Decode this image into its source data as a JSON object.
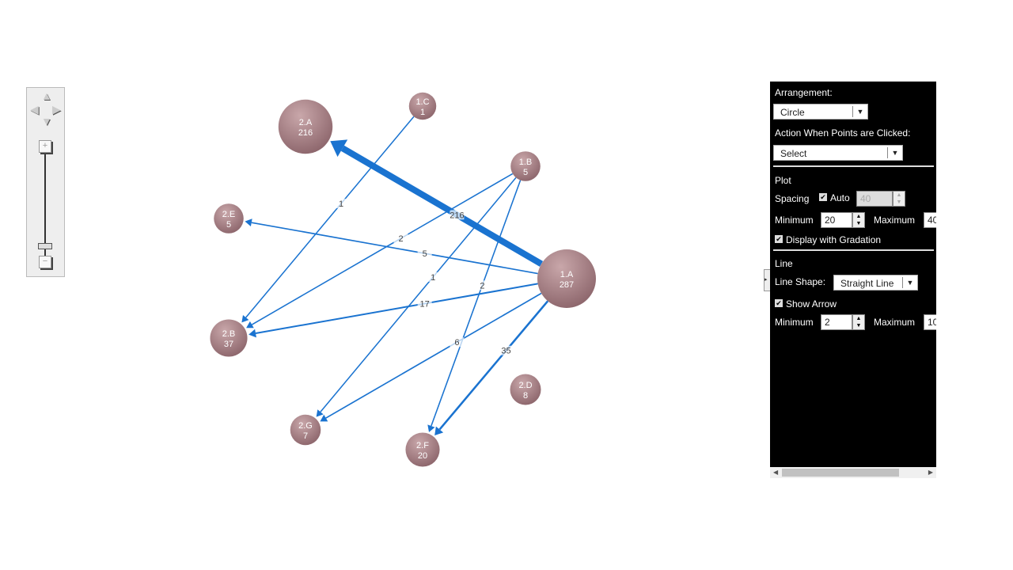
{
  "panel": {
    "arrangement_label": "Arrangement:",
    "arrangement_value": "Circle",
    "action_label": "Action When Points are Clicked:",
    "action_value": "Select",
    "plot_heading": "Plot",
    "spacing_label": "Spacing",
    "auto_label": "Auto",
    "auto_checked": true,
    "spacing_value": "40",
    "plot_min_label": "Minimum",
    "plot_min_value": "20",
    "plot_max_label": "Maximum",
    "plot_max_value": "40",
    "gradation_label": "Display with Gradation",
    "gradation_checked": true,
    "line_heading": "Line",
    "line_shape_label": "Line Shape:",
    "line_shape_value": "Straight Line",
    "show_arrow_label": "Show Arrow",
    "show_arrow_checked": true,
    "line_min_label": "Minimum",
    "line_min_value": "2",
    "line_max_label": "Maximum",
    "line_max_value": "10"
  },
  "chart_data": {
    "type": "network",
    "layout": "circle",
    "node_color": "#9a7276",
    "edge_color": "#1a73d0",
    "nodes": [
      {
        "id": "2.A",
        "value": 216
      },
      {
        "id": "1.C",
        "value": 1
      },
      {
        "id": "1.B",
        "value": 5
      },
      {
        "id": "2.E",
        "value": 5
      },
      {
        "id": "1.A",
        "value": 287
      },
      {
        "id": "2.B",
        "value": 37
      },
      {
        "id": "2.D",
        "value": 8
      },
      {
        "id": "2.G",
        "value": 7
      },
      {
        "id": "2.F",
        "value": 20
      }
    ],
    "edges": [
      {
        "from": "1.C",
        "to": "2.B",
        "value": 1
      },
      {
        "from": "1.A",
        "to": "2.A",
        "value": 216
      },
      {
        "from": "1.B",
        "to": "2.B",
        "value": 2
      },
      {
        "from": "1.A",
        "to": "2.E",
        "value": 5
      },
      {
        "from": "1.B",
        "to": "2.G",
        "value": 1
      },
      {
        "from": "1.B",
        "to": "2.F",
        "value": 2
      },
      {
        "from": "1.A",
        "to": "2.B",
        "value": 17
      },
      {
        "from": "1.A",
        "to": "2.G",
        "value": 6
      },
      {
        "from": "1.A",
        "to": "2.F",
        "value": 35
      }
    ]
  }
}
